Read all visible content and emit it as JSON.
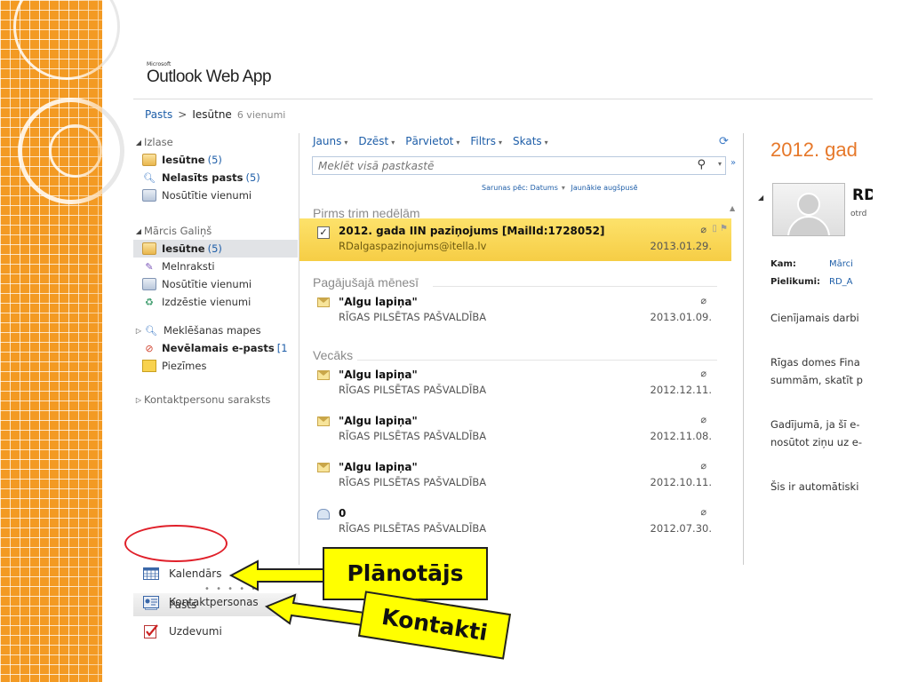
{
  "app": {
    "logo_small": "Microsoft",
    "logo_name": "Outlook Web App"
  },
  "breadcrumb": {
    "root": "Pasts",
    "separator": ">",
    "current": "Iesūtne",
    "count": "6 vienumi"
  },
  "folders": {
    "favorites_label": "Izlase",
    "favorites": [
      {
        "label": "Iesūtne",
        "count": "(5)",
        "bold": true
      },
      {
        "label": "Nelasīts pasts",
        "count": "(5)",
        "bold": true
      },
      {
        "label": "Nosūtītie vienumi",
        "count": ""
      }
    ],
    "mailbox_label": "Mārcis Galiņš",
    "mailbox": [
      {
        "label": "Iesūtne",
        "count": "(5)"
      },
      {
        "label": "Melnraksti",
        "count": ""
      },
      {
        "label": "Nosūtītie vienumi",
        "count": ""
      },
      {
        "label": "Izdzēstie vienumi",
        "count": ""
      }
    ],
    "search_folders": "Meklēšanas mapes",
    "junk": "Nevēlamais e-pasts",
    "junk_count": "[1",
    "notes": "Piezīmes",
    "contacts_list": "Kontaktpersonu saraksts"
  },
  "nav": {
    "dots": "• • • • •",
    "mail": "Pasts",
    "calendar": "Kalendārs",
    "contacts": "Kontaktpersonas",
    "tasks": "Uzdevumi"
  },
  "toolbar": {
    "new": "Jauns",
    "delete": "Dzēst",
    "move": "Pārvietot",
    "filter": "Filtrs",
    "view": "Skats"
  },
  "search": {
    "placeholder": "Meklēt visā pastkastē"
  },
  "sort": {
    "by": "Sarunas pēc: Datums",
    "order": "Jaunākie augšpusē"
  },
  "groups": {
    "g1": "Pirms trim nedēļām",
    "g2": "Pagājušajā mēnesī",
    "g3": "Vecāks"
  },
  "messages": [
    {
      "subject": "2012. gada IIN paziņojums [MailId:1728052]",
      "from": "RDalgaspazinojums@itella.lv",
      "date": "2013.01.29."
    },
    {
      "subject": "\"Algu lapiņa\"",
      "from": "RĪGAS PILSĒTAS PAŠVALDĪBA",
      "date": "2013.01.09."
    },
    {
      "subject": "\"Algu lapiņa\"",
      "from": "RĪGAS PILSĒTAS PAŠVALDĪBA",
      "date": "2012.12.11."
    },
    {
      "subject": "\"Algu lapiņa\"",
      "from": "RĪGAS PILSĒTAS PAŠVALDĪBA",
      "date": "2012.11.08."
    },
    {
      "subject": "\"Algu lapiņa\"",
      "from": "RĪGAS PILSĒTAS PAŠVALDĪBA",
      "date": "2012.10.11."
    },
    {
      "subject": "0",
      "from": "RĪGAS PILSĒTAS PAŠVALDĪBA",
      "date": "2012.07.30."
    }
  ],
  "reading": {
    "title": "2012. gad",
    "sender": "RD",
    "sender_date": "otrd",
    "to_label": "Kam:",
    "to_value": "Mārci",
    "attach_label": "Pielikumi:",
    "attach_value": "RD_A",
    "p1": "Cienījamais darbi",
    "p2a": "Rīgas domes Fina",
    "p2b": "summām, skatīt p",
    "p3a": "Gadījumā, ja šī e-",
    "p3b": "nosūtot ziņu uz e-",
    "p4": "Šis ir automātiski"
  },
  "callouts": {
    "planner": "Plānotājs",
    "contacts": "Kontakti"
  },
  "colors": {
    "accent_orange": "#f39a23",
    "link_blue": "#1e5ea8",
    "selected_yellow": "#f6cd45",
    "callout_yellow": "#ffff00",
    "highlight_red": "#e0202a",
    "title_orange": "#e6782a"
  }
}
